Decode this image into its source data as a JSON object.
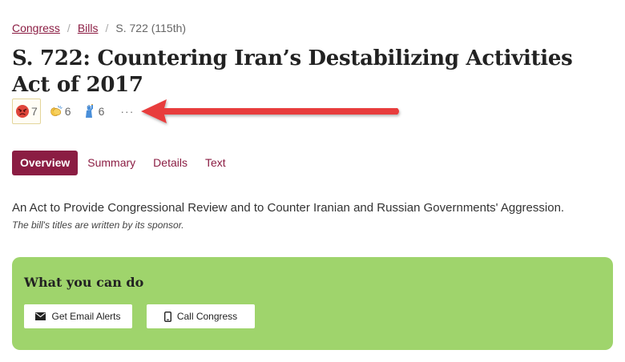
{
  "breadcrumb": {
    "items": [
      "Congress",
      "Bills"
    ],
    "separator": "/",
    "current": "S. 722 (115th)"
  },
  "bill": {
    "title": "S. 722: Countering Iran’s Destabilizing Activities Act of 2017",
    "official_title": "An Act to Provide Congressional Review and to Counter Iranian and Russian Governments' Aggression.",
    "title_note": "The bill's titles are written by its sponsor."
  },
  "reactions": [
    {
      "icon": "angry-face-icon",
      "count": "7",
      "active": true
    },
    {
      "icon": "clapping-hands-icon",
      "count": "6",
      "active": false
    },
    {
      "icon": "statue-of-liberty-icon",
      "count": "6",
      "active": false
    }
  ],
  "reactions_more": "···",
  "tabs": [
    {
      "label": "Overview",
      "active": true
    },
    {
      "label": "Summary",
      "active": false
    },
    {
      "label": "Details",
      "active": false
    },
    {
      "label": "Text",
      "active": false
    }
  ],
  "action_panel": {
    "title": "What you can do",
    "email_button": "Get Email Alerts",
    "call_button": "Call Congress"
  },
  "colors": {
    "brand": "#8b1d43",
    "panel": "#9fd46c",
    "arrow": "#e83e3e"
  }
}
